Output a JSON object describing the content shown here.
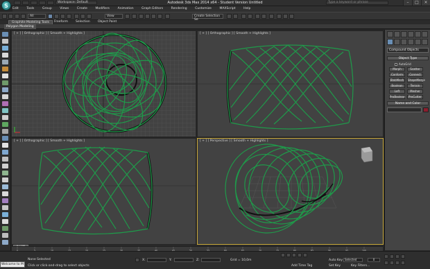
{
  "app": {
    "title": "Autodesk 3ds Max 2014 x64   -   Student Version   Untitled",
    "logo_glyph": "S",
    "search_placeholder": "Type a keyword or phrase"
  },
  "titlebar": {
    "workspace": "Workspace: Default",
    "minimize": "–",
    "maximize": "□",
    "close": "×"
  },
  "menu": [
    "Edit",
    "Tools",
    "Group",
    "Views",
    "Create",
    "Modifiers",
    "Animation",
    "Graph Editors",
    "Rendering",
    "Customize",
    "MAXScript",
    "Help"
  ],
  "toolbar": {
    "selection_filter": "All",
    "coord_system": "View",
    "named_selection": "Create Selection Se"
  },
  "ribbon": {
    "tabs": [
      "Graphite Modeling Tools",
      "Freeform",
      "Selection",
      "Object Paint"
    ],
    "subpanel": "Polygon Modeling"
  },
  "viewports": {
    "top": "[ + ] [ Orthographic ] [ Smooth + Highlights ]",
    "front": "[ + ] [ Orthographic ] [ Smooth + Highlights ]",
    "left": "[ + ] [ Orthographic ] [ Smooth + Highlights ]",
    "perspective": "[ + ] [ Perspective ] [ Smooth + Highlights ]"
  },
  "command_panel": {
    "category": "Compound Objects",
    "object_type_header": "Object Type",
    "autogrid": "AutoGrid",
    "buttons": [
      "Morph",
      "Scatter",
      "Conform",
      "Connect",
      "BlobMesh",
      "ShapeMerge",
      "Boolean",
      "Terrain",
      "Loft",
      "Mesher",
      "ProBoolean",
      "ProCutter"
    ],
    "name_color_header": "Name and Color",
    "object_color": "#8b1e2e"
  },
  "timeline": {
    "frame": "0 / 100",
    "ticks": [
      "0",
      "5",
      "10",
      "15",
      "20",
      "25",
      "30",
      "35",
      "40",
      "45",
      "50",
      "55",
      "60",
      "65",
      "70",
      "75",
      "80",
      "85",
      "90",
      "95",
      "100"
    ]
  },
  "status": {
    "listener": "Welcome to M",
    "selection": "None Selected",
    "prompt": "Click or click-and-drag to select objects",
    "x_label": "X:",
    "y_label": "Y:",
    "z_label": "Z:",
    "grid": "Grid = 10,0m",
    "auto_key": "Auto Key",
    "set_key": "Set Key",
    "key_mode": "Selected",
    "key_filters": "Key Filters...",
    "add_time_tag": "Add Time Tag",
    "frame_field": "0"
  },
  "colors": {
    "accent": "#3aa37a",
    "wire": "#1f9a4a",
    "viewport_bg": "#424242",
    "active_border": "#c9a93a"
  }
}
